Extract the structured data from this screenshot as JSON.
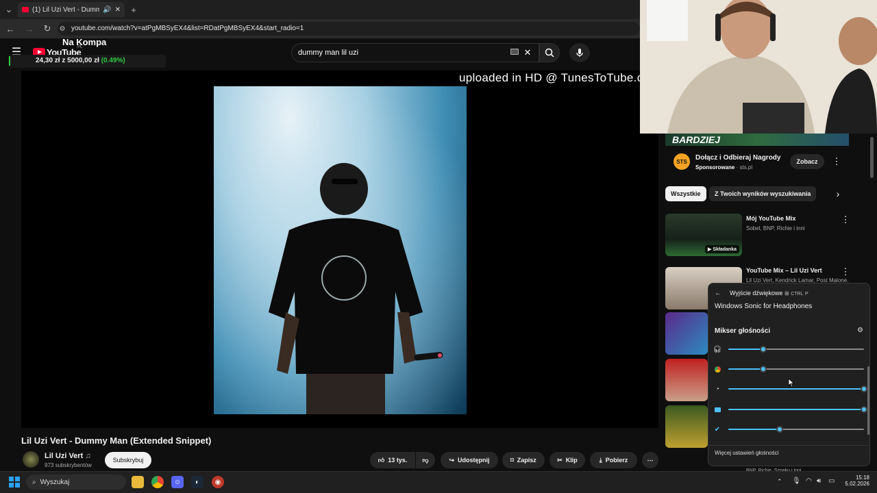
{
  "browser": {
    "tab_title": "(1) Lil Uzi Vert - Dummy Ma",
    "new_tab": "+",
    "url": "youtube.com/watch?v=atPgMBSyEX4&list=RDatPgMBSyEX4&start_radio=1"
  },
  "header": {
    "overlay_channel": "Na Kompa",
    "logo_text": "YouTube",
    "logo_region": "PL",
    "ticker_price": "24,30 zł",
    "ticker_separator": "z",
    "ticker_goal": "5000,00 zł",
    "ticker_percent": "(0.49%)",
    "search_value": "dummy man lil uzi"
  },
  "player": {
    "overlay_text": "uploaded in HD @ TunesToTube.com"
  },
  "video": {
    "title": "Lil Uzi Vert - Dummy Man (Extended Snippet)",
    "channel": "Lil Uzi Vert",
    "subscribers": "973 subskrybentów",
    "subscribe": "Subskrybuj",
    "likes": "13 tys.",
    "share": "Udostępnij",
    "save": "Zapisz",
    "clip": "Klip",
    "download": "Pobierz"
  },
  "sidebar": {
    "banner_text": "BARDZIEJ",
    "ad_icon": "STS",
    "ad_title": "Dołącz i Odbieraj Nagrody",
    "ad_sponsored": "Sponsorowane",
    "ad_domain": "sts.pl",
    "ad_cta": "Zobacz",
    "chips": [
      "Wszystkie",
      "Z Twoich wyników wyszukiwania"
    ],
    "recs": [
      {
        "title": "Mój YouTube Mix",
        "sub": "Sobel, BNP, Richie i inni",
        "badge": "Składanka"
      },
      {
        "title": "YouTube Mix – Lil Uzi Vert",
        "sub": "Lil Uzi Vert, Kendrick Lamar, Post Malone..."
      }
    ],
    "bottom_sub": "BNP, Richie, Szpaku i inni"
  },
  "mixer": {
    "output_label": "Wyjście dźwiękowe",
    "shortcut_ctrl": "CTRL",
    "shortcut_key": "P",
    "device": "Windows Sonic for Headphones",
    "mixer_title": "Mikser głośności",
    "more_settings": "Więcej ustawień głośności",
    "levels": [
      0.26,
      0.26,
      1.0,
      1.0,
      0.38
    ]
  },
  "taskbar": {
    "search_label": "Wyszukaj",
    "time": "15:18",
    "date": "5.02.2026"
  },
  "colors": {
    "youtube_red": "#ff0033",
    "accent_blue": "#4cc2ff",
    "ticker_green": "#2ecc40"
  }
}
